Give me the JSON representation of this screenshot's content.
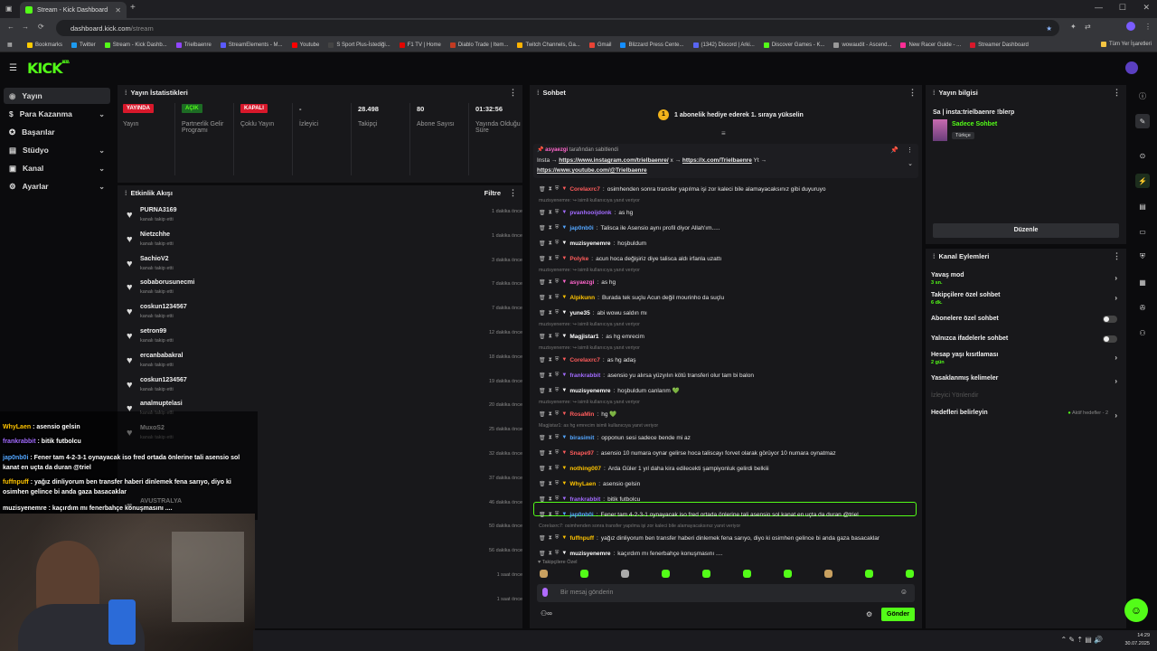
{
  "browser": {
    "tab_title": "Stream - Kick Dashboard",
    "url_host": "dashboard.kick.com",
    "url_path": "/stream",
    "bookmarks": [
      "Bookmarks",
      "Twitter",
      "Stream - Kick Dashb...",
      "Trielbaenre",
      "StreamElements - M...",
      "Youtube",
      "S Sport Plus-İstediği...",
      "F1 TV | Home",
      "Diablo Trade | Item...",
      "Twitch Channels, Ga...",
      "Gmail",
      "Blizzard Press Cente...",
      "(1342) Discord | Arki...",
      "Discover Games - K...",
      "wowaudit - Ascend...",
      "New Racer Guide - ...",
      "Streamer Dashboard"
    ],
    "bookmarks_right": "Tüm Yer İşaretleri"
  },
  "sidebar": {
    "items": [
      {
        "label": "Yayın",
        "icon": "broadcast-icon"
      },
      {
        "label": "Para Kazanma",
        "icon": "money-icon"
      },
      {
        "label": "Başarılar",
        "icon": "trophy-icon"
      },
      {
        "label": "Stüdyo",
        "icon": "studio-icon"
      },
      {
        "label": "Kanal",
        "icon": "channel-icon"
      },
      {
        "label": "Ayarlar",
        "icon": "gear-icon"
      }
    ]
  },
  "stats": {
    "title": "Yayın İstatistikleri",
    "items": [
      {
        "value": "YAYINDA",
        "label": "Yayın"
      },
      {
        "value": "AÇIK",
        "label": "Partnerlik Gelir Programı"
      },
      {
        "value": "KAPALI",
        "label": "Çoklu Yayın"
      },
      {
        "value": "-",
        "label": "İzleyici"
      },
      {
        "value": "28.498",
        "label": "Takipçi"
      },
      {
        "value": "80",
        "label": "Abone Sayısı"
      },
      {
        "value": "01:32:56",
        "label": "Yayında Olduğu Süre"
      }
    ]
  },
  "activity": {
    "title": "Etkinlik Akışı",
    "filter": "Filtre",
    "items": [
      {
        "name": "PURNA3169",
        "sub": "kanalı takip etti",
        "when": "1 dakika önce"
      },
      {
        "name": "Nietzchhe",
        "sub": "kanalı takip etti",
        "when": "1 dakika önce"
      },
      {
        "name": "SachioV2",
        "sub": "kanalı takip etti",
        "when": "3 dakika önce"
      },
      {
        "name": "sobaborusunecmi",
        "sub": "kanalı takip etti",
        "when": "7 dakika önce"
      },
      {
        "name": "coskun1234567",
        "sub": "kanalı takip etti",
        "when": "7 dakika önce"
      },
      {
        "name": "setron99",
        "sub": "kanalı takip etti",
        "when": "12 dakika önce"
      },
      {
        "name": "ercanbabakral",
        "sub": "kanalı takip etti",
        "when": "18 dakika önce"
      },
      {
        "name": "coskun1234567",
        "sub": "kanalı takip etti",
        "when": "19 dakika önce"
      },
      {
        "name": "analmuptelasi",
        "sub": "kanalı takip etti",
        "when": "20 dakika önce"
      },
      {
        "name": "MuxoS2",
        "sub": "kanalı takip etti",
        "when": "25 dakika önce"
      },
      {
        "name": "",
        "sub": "",
        "when": "32 dakika önce"
      },
      {
        "name": "",
        "sub": "",
        "when": "37 dakika önce"
      },
      {
        "name": "AVUSTRALYA",
        "sub": "",
        "when": "46 dakika önce"
      },
      {
        "name": "",
        "sub": "",
        "when": "50 dakika önce"
      },
      {
        "name": "",
        "sub": "",
        "when": "56 dakika önce"
      },
      {
        "name": "",
        "sub": "",
        "when": "1 saat önce"
      },
      {
        "name": "",
        "sub": "",
        "when": "1 saat önce"
      }
    ]
  },
  "chat": {
    "title": "Sohbet",
    "gift_banner": "1 abonelik hediye ederek 1. sıraya yükselin",
    "gift_rank": "1",
    "pinned_by": "asyaezgi",
    "pinned_by_suffix": "tarafından sabitlendi",
    "pinned_line1": "Insta → ",
    "pinned_link1": "https://www.instagram.com/trielbaenre/",
    "pinned_mid": " x → ",
    "pinned_link2": "https://x.com/Trielbaenre",
    "pinned_mid2": " Yt → ",
    "pinned_link3": "https://www.youtube.com/@Trielbaenre",
    "messages": [
      {
        "type": "msg",
        "user": "CoreIaxrc7",
        "color": "#ff5c5c",
        "text": "osimhenden sonra transfer yapılma işi zor kaleci bile alamayacaksınız gibi duyuruyo"
      },
      {
        "type": "reply",
        "text": "muzisyenemre: ↪ isimli kullanıcıya yanıt veriyor"
      },
      {
        "type": "msg",
        "user": "pvanhooijdonk",
        "color": "#a26bff",
        "text": "as hg"
      },
      {
        "type": "msg",
        "user": "jap0nb0i",
        "color": "#53a6ff",
        "text": "Talisca ile Asensio aynı profil diyor Allah'ım....."
      },
      {
        "type": "msg",
        "user": "muzisyenemre",
        "color": "#ffffff",
        "text": "hoşbuldum"
      },
      {
        "type": "msg",
        "user": "Polyke",
        "color": "#ff5c5c",
        "text": "acun hoca değişiriz diye talisca aldı irfanla uzattı"
      },
      {
        "type": "reply",
        "text": "muzisyenemre: ↪ isimli kullanıcıya yanıt veriyor"
      },
      {
        "type": "msg",
        "user": "asyaezgi",
        "color": "#ff66cc",
        "text": "as hg"
      },
      {
        "type": "msg",
        "user": "Alpikunn",
        "color": "#ffc400",
        "text": "Burada tek suçlu Acun değil mourinho da suçlu"
      },
      {
        "type": "msg",
        "user": "yune35",
        "color": "#ffffff",
        "text": "abi wowu saldın mı"
      },
      {
        "type": "reply",
        "text": "muzisyenemre: ↪ isimli kullanıcıya yanıt veriyor"
      },
      {
        "type": "msg",
        "user": "Magjistar1",
        "color": "#ffffff",
        "text": "as hg emrecim"
      },
      {
        "type": "reply",
        "text": "muzisyenemre: ↪ isimli kullanıcıya yanıt veriyor"
      },
      {
        "type": "msg",
        "user": "CoreIaxrc7",
        "color": "#ff5c5c",
        "text": "as hg adaş"
      },
      {
        "type": "msg",
        "user": "frankrabbit",
        "color": "#a26bff",
        "text": "asensio yu alırsa yüzyılın kötü transferi olur tam bi balon"
      },
      {
        "type": "msg",
        "user": "muzisyenemre",
        "color": "#ffffff",
        "text": "hoşbuldum canlarım 💚"
      },
      {
        "type": "reply",
        "text": "muzisyenemre: ↪ isimli kullanıcıya yanıt veriyor"
      },
      {
        "type": "msg",
        "user": "RosaMin",
        "color": "#ff5c5c",
        "text": "hg 💚"
      },
      {
        "type": "reply",
        "text": "Magjistar1: as hg emrecim isimli kullanıcıya yanıt veriyor"
      },
      {
        "type": "msg",
        "user": "birasimit",
        "color": "#53a6ff",
        "text": "opponun sesi sadece bende mi az"
      },
      {
        "type": "msg",
        "user": "Snape97",
        "color": "#ff5c5c",
        "text": "asensio 10 numara oynar gelirse hoca taliscayı forvet olarak görüyor 10 numara oynatmaz"
      },
      {
        "type": "msg",
        "user": "nothing007",
        "color": "#ffc400",
        "text": "Arda Güler 1 yıl daha kira edilecekti şampiyonluk gelirdi belkiii"
      },
      {
        "type": "msg",
        "user": "WhyLaen",
        "color": "#ffc400",
        "text": "asensio gelsin"
      },
      {
        "type": "msg",
        "user": "frankrabbit",
        "color": "#a26bff",
        "text": "bitik futbolcu"
      },
      {
        "type": "msg",
        "user": "jap0nb0i",
        "color": "#53a6ff",
        "text": "Fener tam 4-2-3-1 oynayacak iso fred ortada önlerine tali asensio sol kanat en uçta da duran @triel"
      },
      {
        "type": "reply",
        "text": "CoreIaxrc7: osimhenden sonra transfer yapılma işi zor kaleci bile alamayacaksınız yanıt veriyor"
      },
      {
        "type": "msg",
        "user": "fuffnpuff",
        "color": "#ffc400",
        "text": "yağız dinliyorum ben transfer haberi dinlemek fena sarıyo, diyo ki osimhen gelince bi anda gaza basacaklar"
      },
      {
        "type": "msg",
        "user": "muzisyenemre",
        "color": "#ffffff",
        "text": "kaçırdım mı fenerbahçe konuşmasını ...."
      }
    ],
    "followers_only": "Takipçilere Özel",
    "input_placeholder": "Bir mesaj gönderin",
    "send_label": "Gönder"
  },
  "stream_info": {
    "title": "Yayın bilgisi",
    "stream_title": "Sa | insta:trielbaenre !blerp",
    "category": "Sadece Sohbet",
    "language": "Türkçe",
    "edit_label": "Düzenle"
  },
  "channel_actions": {
    "title": "Kanal Eylemleri",
    "rows": [
      {
        "label": "Yavaş mod",
        "sub": "3 sn.",
        "kind": "arrow"
      },
      {
        "label": "Takipçilere özel sohbet",
        "sub": "6 dk.",
        "kind": "arrow"
      },
      {
        "label": "Abonelere özel sohbet",
        "sub": "",
        "kind": "toggle"
      },
      {
        "label": "Yalnızca ifadelerle sohbet",
        "sub": "",
        "kind": "toggle"
      },
      {
        "label": "Hesap yaşı kısıtlaması",
        "sub": "2 gün",
        "kind": "arrow"
      },
      {
        "label": "Yasaklanmış kelimeler",
        "sub": "",
        "kind": "arrow"
      },
      {
        "label": "İzleyici Yönlendir",
        "sub": "",
        "kind": "disabled"
      },
      {
        "label": "Hedefleri belirleyin",
        "sub": "",
        "kind": "goals"
      }
    ],
    "goals_status": "Aktif hedefler - 2"
  },
  "overlay": {
    "lines": [
      {
        "user": "WhyLaen",
        "text": "asensio gelsin"
      },
      {
        "user": "frankrabbit",
        "text": "bitik futbolcu"
      },
      {
        "user": "jap0nb0i",
        "text": "Fener tam 4-2-3-1 oynayacak iso fred ortada önlerine tali asensio sol kanat en uçta da duran @triel"
      },
      {
        "user": "fuffnpuff",
        "text": "yağız dinliyorum ben transfer haberi dinlemek fena sarıyo, diyo ki osimhen gelince bi anda gaza basacaklar"
      },
      {
        "user": "muzisyenemre",
        "text": "kaçırdım mı fenerbahçe konuşmasını ...."
      }
    ]
  },
  "taskbar": {
    "time": "14:29",
    "date": "30.07.2025"
  }
}
